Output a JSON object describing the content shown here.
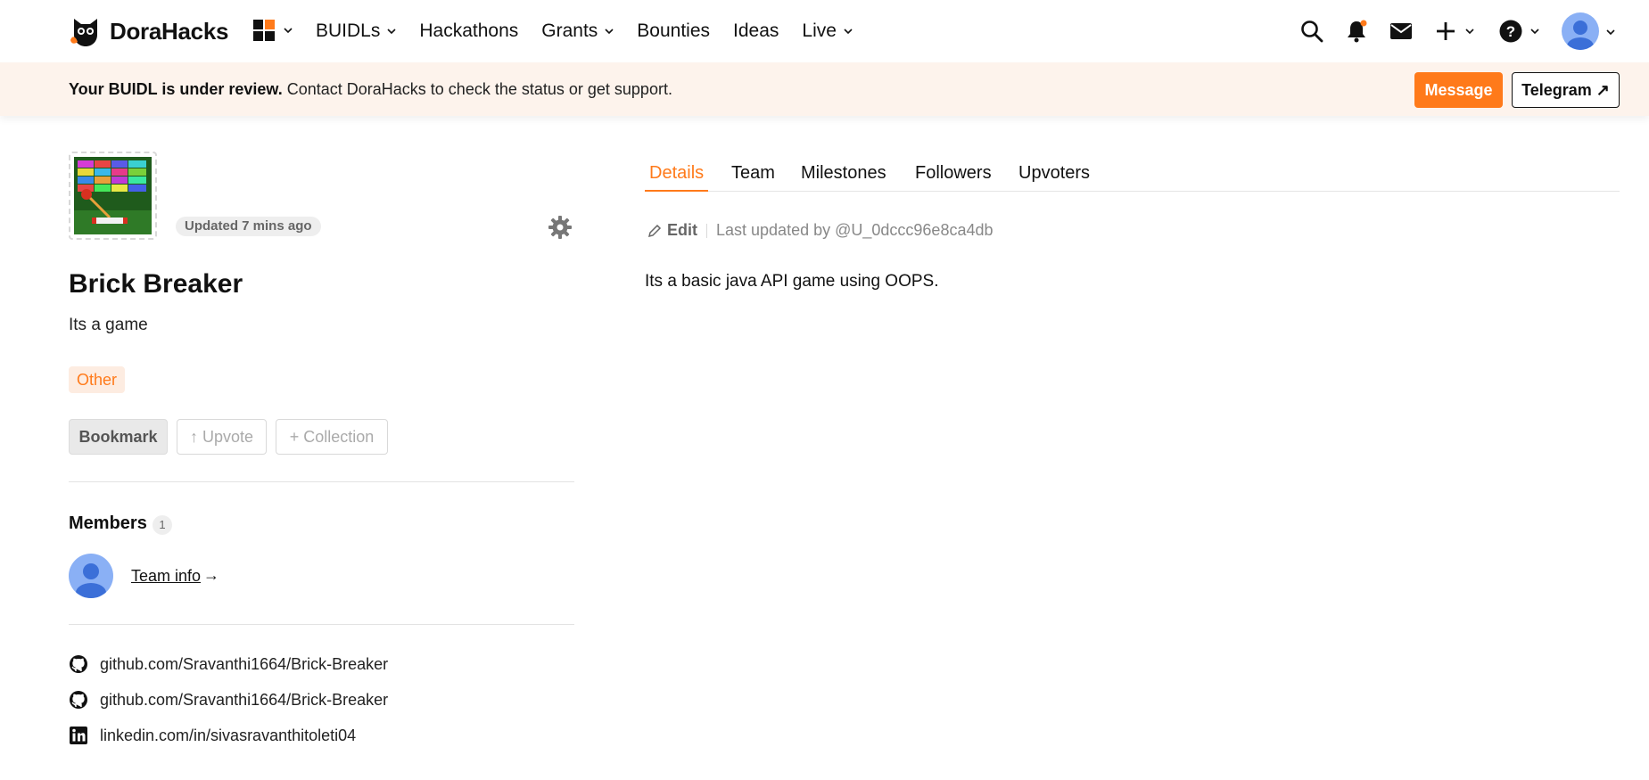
{
  "brand": {
    "name": "DoraHacks"
  },
  "nav": {
    "items": [
      {
        "label": "BUIDLs",
        "dropdown": true
      },
      {
        "label": "Hackathons",
        "dropdown": false
      },
      {
        "label": "Grants",
        "dropdown": true
      },
      {
        "label": "Bounties",
        "dropdown": false
      },
      {
        "label": "Ideas",
        "dropdown": false
      },
      {
        "label": "Live",
        "dropdown": true
      }
    ],
    "right_icons": [
      "search-icon",
      "bell-icon",
      "mail-icon",
      "plus-icon",
      "help-icon",
      "avatar"
    ]
  },
  "banner": {
    "bold": "Your BUIDL is under review.",
    "text": " Contact DoraHacks to check the status or get support.",
    "message_label": "Message",
    "telegram_label": "Telegram ↗"
  },
  "project": {
    "updated": "Updated 7 mins ago",
    "title": "Brick Breaker",
    "subtitle": "Its a game",
    "tag": "Other",
    "actions": {
      "bookmark": "Bookmark",
      "upvote": "↑ Upvote",
      "collection": "+ Collection"
    },
    "members": {
      "title": "Members",
      "count": "1",
      "team_info": "Team info",
      "arrow": "→"
    },
    "links": [
      {
        "icon": "github-icon",
        "text": "github.com/Sravanthi1664/Brick-Breaker"
      },
      {
        "icon": "github-icon",
        "text": "github.com/Sravanthi1664/Brick-Breaker"
      },
      {
        "icon": "linkedin-icon",
        "text": "linkedin.com/in/sivasravanthitoleti04"
      }
    ]
  },
  "tabs": [
    {
      "label": "Details",
      "active": true
    },
    {
      "label": "Team",
      "active": false
    },
    {
      "label": "Milestones",
      "active": false
    },
    {
      "label": "Followers",
      "active": false
    },
    {
      "label": "Upvoters",
      "active": false
    }
  ],
  "details": {
    "edit_label": "Edit",
    "last_updated": "Last updated by @U_0dccc96e8ca4db",
    "body": "Its a basic java API game using OOPS."
  },
  "colors": {
    "accent": "#ff7a1a",
    "banner_bg": "#fdf3ec",
    "tag_bg": "#fdece1",
    "avatar_bg": "#8ab0f5"
  }
}
